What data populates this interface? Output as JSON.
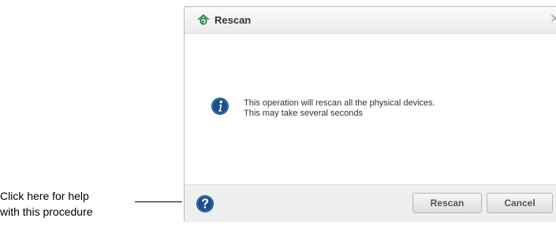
{
  "dialog": {
    "title": "Rescan",
    "close_symbol": "✕",
    "message_line1": "This operation will rescan all the physical devices.",
    "message_line2": "This may take several seconds",
    "icons": {
      "title": "rescan-icon",
      "info": "info-icon",
      "help": "help-icon"
    },
    "buttons": {
      "rescan": "Rescan",
      "cancel": "Cancel"
    }
  },
  "callout": {
    "line1": "Click here for help",
    "line2": "with this procedure"
  },
  "colors": {
    "info_icon": "#1b4f8a",
    "help_icon": "#1b4f8a",
    "title_icon_green": "#3aa86b"
  }
}
